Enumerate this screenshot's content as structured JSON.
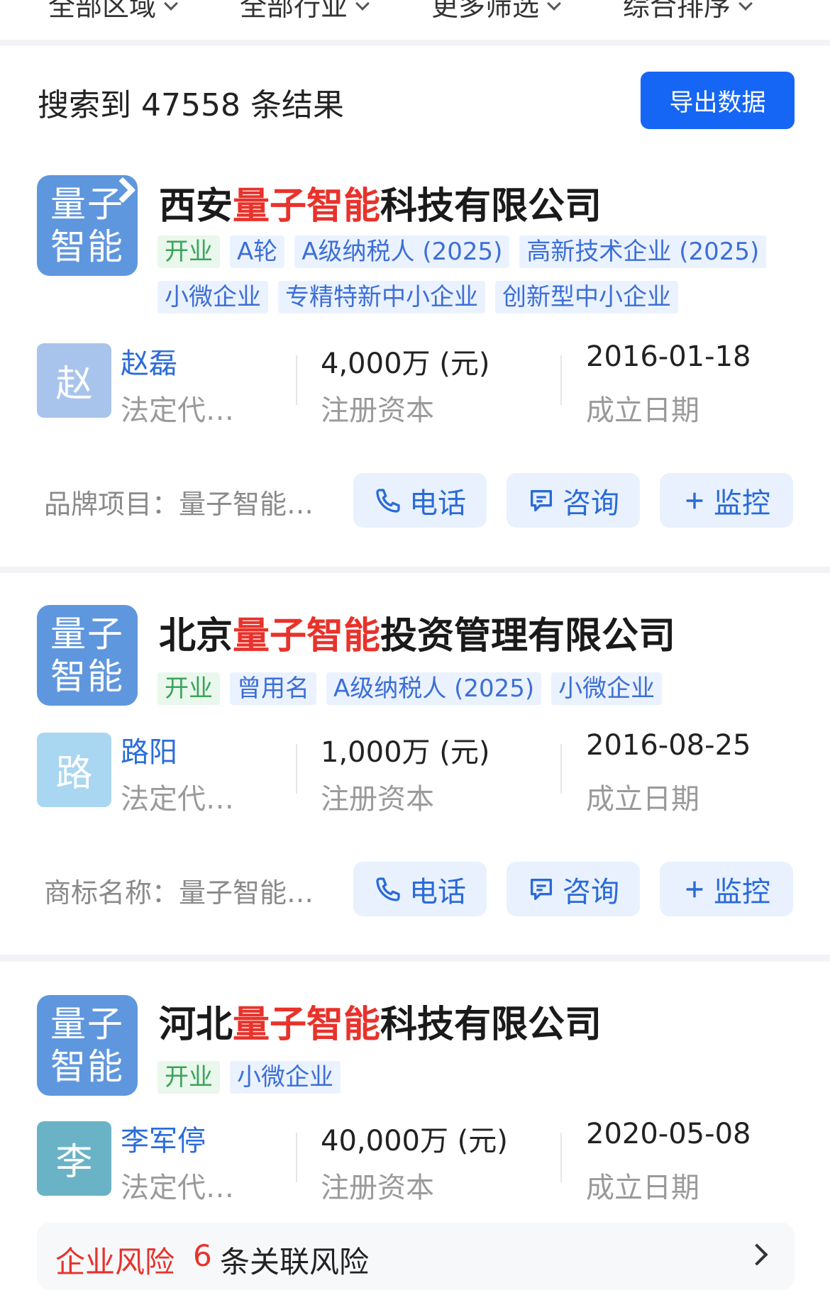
{
  "filters": [
    {
      "label": "全部区域"
    },
    {
      "label": "全部行业"
    },
    {
      "label": "更多筛选"
    },
    {
      "label": "综合排序"
    }
  ],
  "summary": {
    "result_text": "搜索到 47558 条结果",
    "export_label": "导出数据"
  },
  "companies": [
    {
      "logo_line1": "量子",
      "logo_line2": "智能",
      "name_prefix": "西安",
      "name_highlight": "量子智能",
      "name_suffix": "科技有限公司",
      "tags": [
        "开业",
        "A轮",
        "A级纳税人 (2025)",
        "高新技术企业 (2025)",
        "小微企业",
        "专精特新中小企业",
        "创新型中小企业"
      ],
      "rep_initial": "赵",
      "rep_name": "赵磊",
      "rep_label": "法定代…",
      "capital": "4,000万 (元)",
      "capital_label": "注册资本",
      "date": "2016-01-18",
      "date_label": "成立日期",
      "extra": "品牌项目：量子智能…"
    },
    {
      "logo_line1": "量子",
      "logo_line2": "智能",
      "name_prefix": "北京",
      "name_highlight": "量子智能",
      "name_suffix": "投资管理有限公司",
      "tags": [
        "开业",
        "曾用名",
        "A级纳税人 (2025)",
        "小微企业"
      ],
      "rep_initial": "路",
      "rep_name": "路阳",
      "rep_label": "法定代…",
      "capital": "1,000万 (元)",
      "capital_label": "注册资本",
      "date": "2016-08-25",
      "date_label": "成立日期",
      "extra": "商标名称：量子智能…"
    },
    {
      "logo_line1": "量子",
      "logo_line2": "智能",
      "name_prefix": "河北",
      "name_highlight": "量子智能",
      "name_suffix": "科技有限公司",
      "tags": [
        "开业",
        "小微企业"
      ],
      "rep_initial": "李",
      "rep_name": "李军停",
      "rep_label": "法定代…",
      "capital": "40,000万 (元)",
      "capital_label": "注册资本",
      "date": "2020-05-08",
      "date_label": "成立日期"
    }
  ],
  "actions": {
    "phone": "电话",
    "consult": "咨询",
    "monitor": "监控"
  },
  "risk": {
    "title": "企业风险",
    "count": "6",
    "text": "条关联风险"
  },
  "colors": {
    "accent": "#1666f5",
    "highlight": "#e8322b",
    "avatar_zhao": "#a9c4ec",
    "avatar_lu": "#a9d6f1",
    "avatar_li": "#6ab3c6"
  }
}
